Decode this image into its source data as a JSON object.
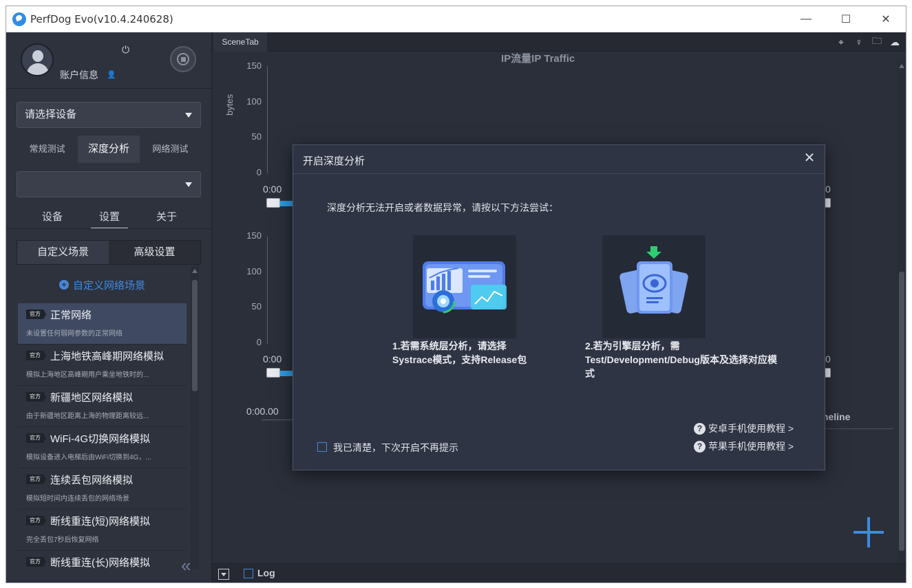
{
  "window": {
    "title": "PerfDog Evo(v10.4.240628)",
    "controls": {
      "minimize": "—",
      "maximize": "☐",
      "close": "✕"
    }
  },
  "sidebar": {
    "account_label": "账户信息",
    "device_select": "请选择设备",
    "app_select": "",
    "mode_tabs": [
      "常规测试",
      "深度分析",
      "网络测试"
    ],
    "mode_active": "深度分析",
    "sub_tabs": [
      "设备",
      "设置",
      "关于"
    ],
    "sub_active": "设置",
    "scene_tabs": [
      "自定义场景",
      "高级设置"
    ],
    "add_scene": "自定义网络场景",
    "badge": "官方",
    "scenes": [
      {
        "name": "正常网络",
        "desc": "未设置任何弱网参数的正常网络"
      },
      {
        "name": "上海地铁高峰期网络模拟",
        "desc": "模拟上海地区高峰期用户乘坐地铁时的..."
      },
      {
        "name": "新疆地区网络模拟",
        "desc": "由于新疆地区距离上海的物理距离较远..."
      },
      {
        "name": "WiFi-4G切换网络模拟",
        "desc": "模拟设备进入电梯后由WiFi切换到4G，..."
      },
      {
        "name": "连续丢包网络模拟",
        "desc": "模拟短时间内连续丢包的网络场景"
      },
      {
        "name": "断线重连(短)网络模拟",
        "desc": "完全丢包7秒后恢复网络"
      },
      {
        "name": "断线重连(长)网络模拟",
        "desc": ""
      }
    ],
    "collapse_icon": "«"
  },
  "main": {
    "scene_tab": "SceneTab",
    "chart_title": "IP流量IP Traffic",
    "ylabel": "bytes",
    "yticks_top": [
      "150",
      "100",
      "50",
      "0"
    ],
    "yticks_bottom": [
      "150",
      "100",
      "50",
      "0"
    ],
    "time_start": "0:00",
    "time_end": "0",
    "timeline_start": "0:00.00",
    "timeline_label": "meline",
    "log_label": "Log"
  },
  "dialog": {
    "title": "开启深度分析",
    "message": "深度分析无法开启或者数据异常，请按以下方法尝试：",
    "option1": "1.若需系统层分析，请选择Systrace模式，支持Release包",
    "option2": "2.若为引擎层分析，需Test/Development/Debug版本及选择对应模式",
    "help_android": "安卓手机使用教程 >",
    "help_ios": "苹果手机使用教程 >",
    "dont_show": "我已清楚，下次开启不再提示"
  },
  "colors": {
    "accent": "#3f8ae0",
    "slider": "#2e9be6",
    "download_arrow": "#2ecc71"
  }
}
